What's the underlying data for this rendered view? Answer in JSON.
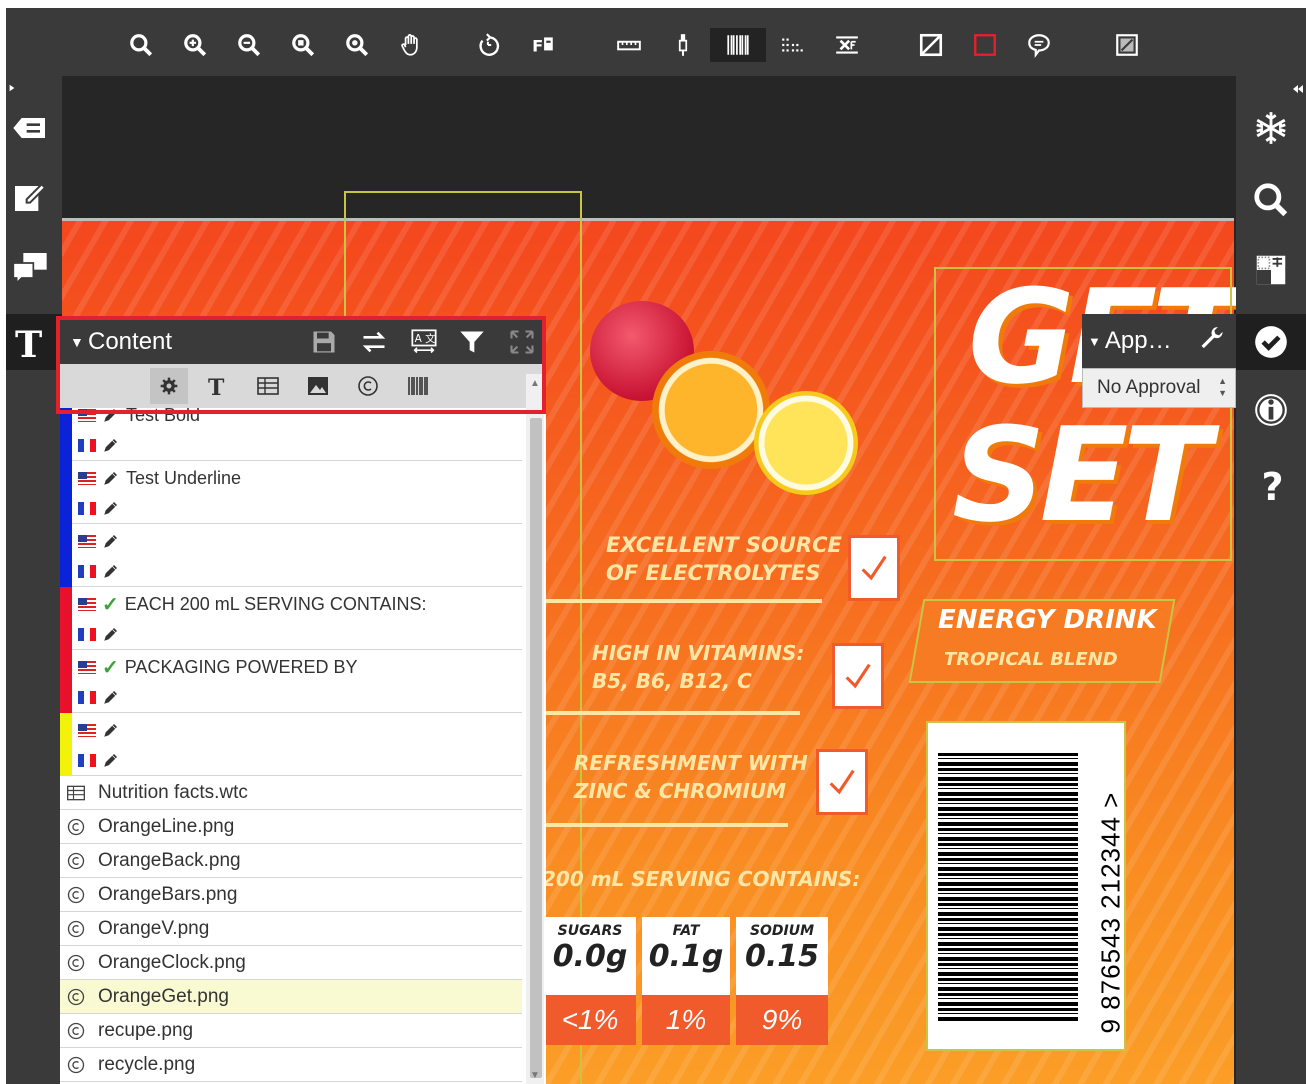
{
  "toolbar": {
    "tools": [
      "zoom-fit-icon",
      "zoom-in-icon",
      "zoom-out-icon",
      "zoom-page-icon",
      "zoom-selection-icon",
      "pan-hand-icon",
      "rotate-icon",
      "find-replace-icon",
      "ruler-icon",
      "eyedropper-icon",
      "barcode-icon",
      "dot-grid-icon",
      "text-compare-icon",
      "mask-icon",
      "rectangle-icon",
      "comment-icon",
      "compare-icon"
    ]
  },
  "left_rail": {
    "items": [
      "label-icon",
      "edit-note-icon",
      "comments-icon",
      "text-icon"
    ]
  },
  "right_rail": {
    "items": [
      "snowflake-icon",
      "search-icon",
      "checker-icon",
      "approval-check-icon",
      "info-icon",
      "help-icon"
    ]
  },
  "content_panel": {
    "title": "Content",
    "rows": [
      {
        "color": "#0a23d9",
        "lines": [
          {
            "flag": "us",
            "icon": "pencil",
            "text": "Test Bold"
          },
          {
            "flag": "fr",
            "icon": "pencil",
            "text": ""
          }
        ]
      },
      {
        "color": "#0a23d9",
        "lines": [
          {
            "flag": "us",
            "icon": "pencil",
            "text": "Test Underline"
          },
          {
            "flag": "fr",
            "icon": "pencil",
            "text": ""
          }
        ]
      },
      {
        "color": "#0a23d9",
        "lines": [
          {
            "flag": "us",
            "icon": "pencil",
            "text": ""
          },
          {
            "flag": "fr",
            "icon": "pencil",
            "text": ""
          }
        ]
      },
      {
        "color": "#e8102a",
        "lines": [
          {
            "flag": "us",
            "icon": "check",
            "text": "EACH 200 mL SERVING CONTAINS:"
          },
          {
            "flag": "fr",
            "icon": "pencil",
            "text": ""
          }
        ]
      },
      {
        "color": "#e8102a",
        "lines": [
          {
            "flag": "us",
            "icon": "check",
            "text": "PACKAGING POWERED BY"
          },
          {
            "flag": "fr",
            "icon": "pencil",
            "text": ""
          }
        ]
      },
      {
        "color": "#f2f20a",
        "lines": [
          {
            "flag": "us",
            "icon": "pencil",
            "text": ""
          },
          {
            "flag": "fr",
            "icon": "pencil",
            "text": ""
          }
        ]
      }
    ],
    "files": [
      {
        "icon": "table",
        "name": "Nutrition facts.wtc"
      },
      {
        "icon": "copyright",
        "name": "OrangeLine.png"
      },
      {
        "icon": "copyright",
        "name": "OrangeBack.png"
      },
      {
        "icon": "copyright",
        "name": "OrangeBars.png"
      },
      {
        "icon": "copyright",
        "name": "OrangeV.png"
      },
      {
        "icon": "copyright",
        "name": "OrangeClock.png"
      },
      {
        "icon": "copyright",
        "name": "OrangeGet.png",
        "selected": true
      },
      {
        "icon": "copyright",
        "name": "recupe.png"
      },
      {
        "icon": "copyright",
        "name": "recycle.png"
      }
    ]
  },
  "approval": {
    "title": "App…",
    "value": "No Approval"
  },
  "artwork": {
    "brand_top": "GET",
    "brand_bottom": "SET",
    "energy": "ENERGY DRINK",
    "blend": "TROPICAL BLEND",
    "claim1a": "EXCELLENT SOURCE",
    "claim1b": "OF ELECTROLYTES",
    "claim2a": "HIGH IN VITAMINS:",
    "claim2b": "B5, B6, B12, C",
    "claim3a": "REFRESHMENT WITH",
    "claim3b": "ZINC & CHROMIUM",
    "serving": "200 mL SERVING CONTAINS:",
    "nutrients": [
      {
        "label": "SUGARS",
        "amount": "0.0g",
        "dv": "<1%"
      },
      {
        "label": "FAT",
        "amount": "0.1g",
        "dv": "1%"
      },
      {
        "label": "SODIUM",
        "amount": "0.15",
        "dv": "9%"
      }
    ],
    "barcode": "9 876543 212344 >"
  }
}
